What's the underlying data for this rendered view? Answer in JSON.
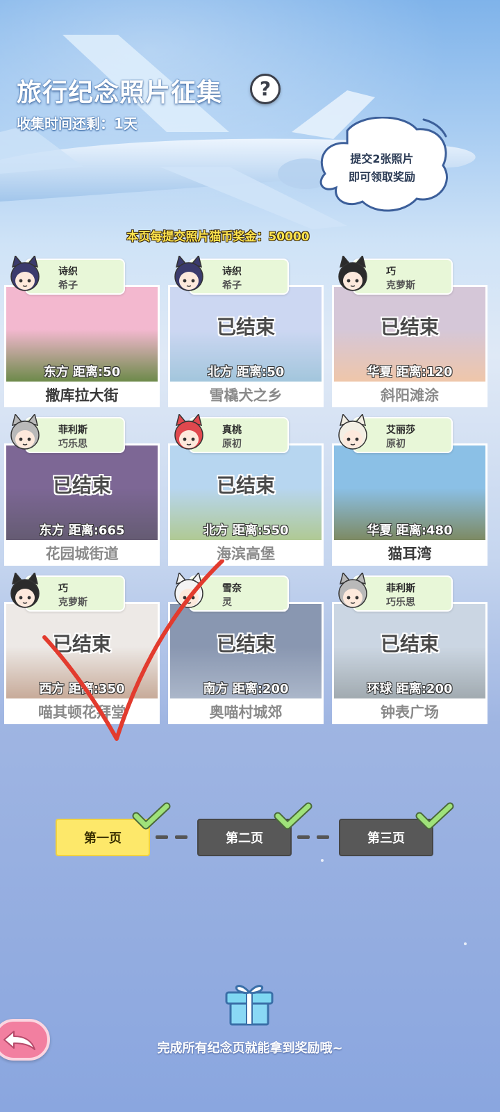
{
  "header": {
    "title": "旅行纪念照片征集",
    "help_symbol": "?",
    "time_left": "收集时间还剩：1天"
  },
  "bubble": {
    "line1": "提交2张照片",
    "line2": "即可领取奖励"
  },
  "reward_info": "本页每提交照片猫币奖金：50000",
  "cards": [
    {
      "name": "撒库拉大街",
      "direction_distance": "东方  距离:50",
      "tag_line1": "诗织",
      "tag_line2": "希子",
      "ended": false,
      "ended_label": "",
      "photo_top": "#f3b8cf",
      "photo_bottom": "#6d8a4a",
      "avatar_hair": "#3b3b6d"
    },
    {
      "name": "雪橇犬之乡",
      "direction_distance": "北方  距离:50",
      "tag_line1": "诗织",
      "tag_line2": "希子",
      "ended": true,
      "ended_label": "已结束",
      "photo_top": "#b9c8ee",
      "photo_bottom": "#7fb0cf",
      "avatar_hair": "#3b3b6d"
    },
    {
      "name": "斜阳滩涂",
      "direction_distance": "华夏  距离:120",
      "tag_line1": "巧",
      "tag_line2": "克萝斯",
      "ended": true,
      "ended_label": "已结束",
      "photo_top": "#c5b2c9",
      "photo_bottom": "#e9b089",
      "avatar_hair": "#2b2b2b"
    },
    {
      "name": "花园城街道",
      "direction_distance": "东方  距离:665",
      "tag_line1": "菲利斯",
      "tag_line2": "巧乐思",
      "ended": true,
      "ended_label": "已结束",
      "photo_top": "#4b2d6d",
      "photo_bottom": "#2a1d3d",
      "avatar_hair": "#b9b9b9"
    },
    {
      "name": "海滨高堡",
      "direction_distance": "北方  距离:550",
      "tag_line1": "真桃",
      "tag_line2": "原初",
      "ended": true,
      "ended_label": "已结束",
      "photo_top": "#9cc6ea",
      "photo_bottom": "#92b56b",
      "avatar_hair": "#e0484e"
    },
    {
      "name": "猫耳湾",
      "direction_distance": "华夏  距离:480",
      "tag_line1": "艾丽莎",
      "tag_line2": "原初",
      "ended": false,
      "ended_label": "",
      "photo_top": "#8bc0e6",
      "photo_bottom": "#7d8a63",
      "avatar_hair": "#f3efe4"
    },
    {
      "name": "喵其顿花拜堂",
      "direction_distance": "西方  距离:350",
      "tag_line1": "巧",
      "tag_line2": "克萝斯",
      "ended": true,
      "ended_label": "已结束",
      "photo_top": "#e6e1dd",
      "photo_bottom": "#b28a72",
      "avatar_hair": "#2b2b2b"
    },
    {
      "name": "奥喵村城郊",
      "direction_distance": "南方  距离:200",
      "tag_line1": "雪奈",
      "tag_line2": "灵",
      "ended": true,
      "ended_label": "已结束",
      "photo_top": "#5c6f93",
      "photo_bottom": "#8b9bb5",
      "avatar_hair": "#f4f4f4"
    },
    {
      "name": "钟表广场",
      "direction_distance": "环球  距离:200",
      "tag_line1": "菲利斯",
      "tag_line2": "巧乐思",
      "ended": true,
      "ended_label": "已结束",
      "photo_top": "#b8c7d8",
      "photo_bottom": "#7d8a92",
      "avatar_hair": "#b9b9b9"
    }
  ],
  "pager": {
    "pages": [
      {
        "label": "第一页",
        "active": true,
        "completed": true
      },
      {
        "label": "第二页",
        "active": false,
        "completed": true
      },
      {
        "label": "第三页",
        "active": false,
        "completed": true
      }
    ]
  },
  "footer": {
    "note": "完成所有纪念页就能拿到奖励哦~"
  },
  "colors": {
    "check_green": "#9fe27a",
    "active_page": "#fde86a",
    "inactive_page": "#585858",
    "tag_bg": "#e8f7d8",
    "reward_text": "#ffe44d",
    "overlay_check": "#e23b2e"
  }
}
